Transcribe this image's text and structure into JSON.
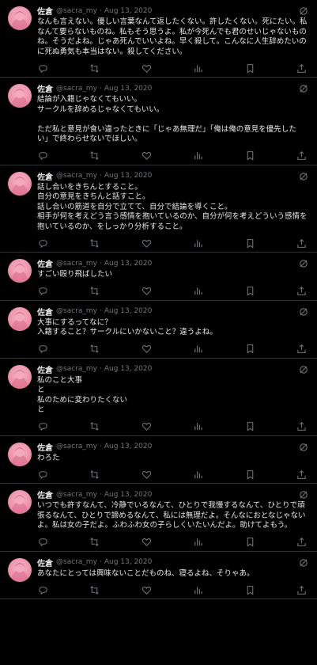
{
  "tweets": [
    {
      "name": "佐倉",
      "handle": "@sacra_my",
      "sep": "·",
      "date": "Aug 13, 2020",
      "text": "なんも言えない。優しい言葉なんて返したくない。許したくない。死にたい。私なんて要らないものね。私もそう思うよ。私が今死んでも君のせいじゃないものね。そうだよね。じゃあ死んでいいよね。早く殺して。こんなに人生辞めたいのに死ぬ勇気も本当はない。殺してください。"
    },
    {
      "name": "佐倉",
      "handle": "@sacra_my",
      "sep": "·",
      "date": "Aug 13, 2020",
      "text": "結論が入籍じゃなくてもいい。\nサークルを辞めるじゃなくてもいい。\n\nただ私と意見が食い違ったときに「じゃあ無理だ」「俺は俺の意見を優先したい」で終わらせないでほしい。"
    },
    {
      "name": "佐倉",
      "handle": "@sacra_my",
      "sep": "·",
      "date": "Aug 13, 2020",
      "text": "話し合いをきちんとすること。\n自分の意見をきちんと話すこと。\n話し合いの筋道を自分で立てて、自分で結論を導くこと。\n相手が何を考えどう言う感情を抱いているのか、自分が何を考えどういう感情を抱いているのか、をしっかり分析すること。"
    },
    {
      "name": "佐倉",
      "handle": "@sacra_my",
      "sep": "·",
      "date": "Aug 13, 2020",
      "text": "すごい殴り飛ばしたい"
    },
    {
      "name": "佐倉",
      "handle": "@sacra_my",
      "sep": "·",
      "date": "Aug 13, 2020",
      "text": "大事にするってなに？\n入籍すること？サークルにいかないこと？違うよね。"
    },
    {
      "name": "佐倉",
      "handle": "@sacra_my",
      "sep": "·",
      "date": "Aug 13, 2020",
      "text": "私のこと大事\nと\n私のために変わりたくない\nと"
    },
    {
      "name": "佐倉",
      "handle": "@sacra_my",
      "sep": "·",
      "date": "Aug 13, 2020",
      "text": "わろた"
    },
    {
      "name": "佐倉",
      "handle": "@sacra_my",
      "sep": "·",
      "date": "Aug 13, 2020",
      "text": "いつでも許すなんて、冷静でいるなんて、ひとりで我慢するなんて、ひとりで頑張るなんて、ひとりで諦めるなんて、私には無理だよ。そんなにおとなじゃないよ。私は女の子だよ。ふわふわ女の子らしくいたいんだよ。助けてよもう。"
    },
    {
      "name": "佐倉",
      "handle": "@sacra_my",
      "sep": "·",
      "date": "Aug 13, 2020",
      "text": "あなたにとっては興味ないことだものね、寝るよね、そりゃあ。"
    }
  ]
}
